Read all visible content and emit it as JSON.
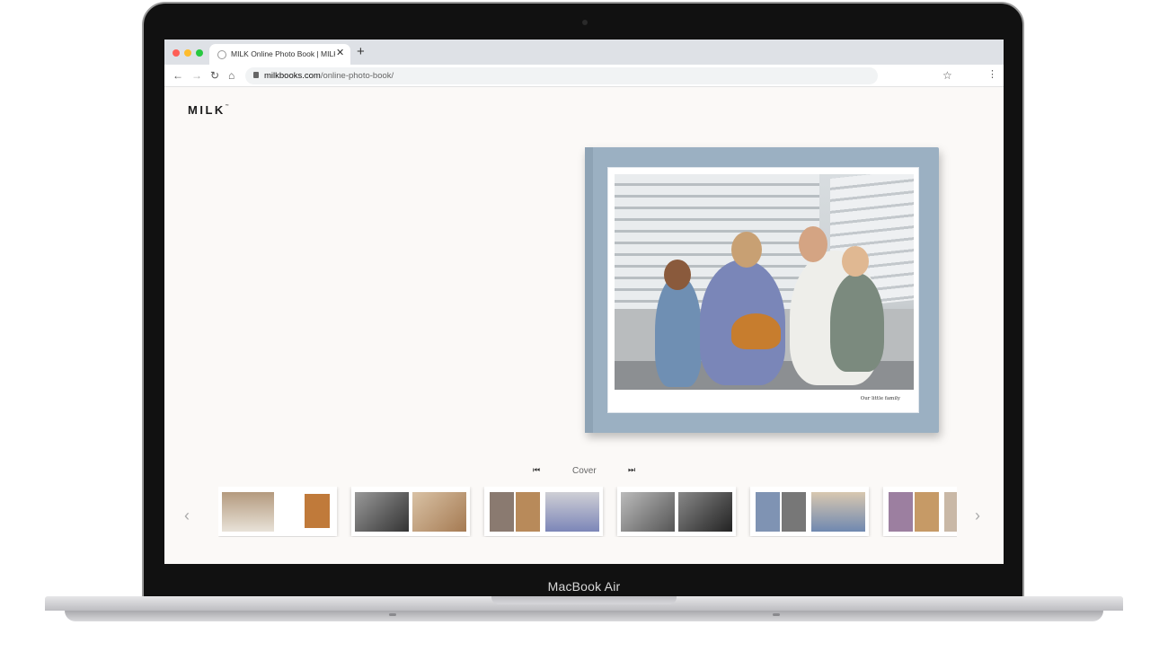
{
  "device": {
    "label": "MacBook Air"
  },
  "browser": {
    "tab_title": "MILK Online Photo Book | MILK B",
    "tab_close": "✕",
    "new_tab": "+",
    "url_host": "milkbooks.com",
    "url_path": "/online-photo-book/",
    "icons": {
      "back": "←",
      "forward": "→",
      "reload": "↻",
      "home": "⌂",
      "star": "☆",
      "menu": "⋮"
    }
  },
  "page": {
    "logo": "MILK",
    "logo_mark": "™",
    "book": {
      "caption": "Our little family",
      "cover_color": "#9bb0c2"
    },
    "pager": {
      "label": "Cover",
      "first_icon": "⏮",
      "last_icon": "⏭"
    },
    "carousel": {
      "prev_icon": "‹",
      "next_icon": "›",
      "thumbnail_count": 6
    }
  }
}
